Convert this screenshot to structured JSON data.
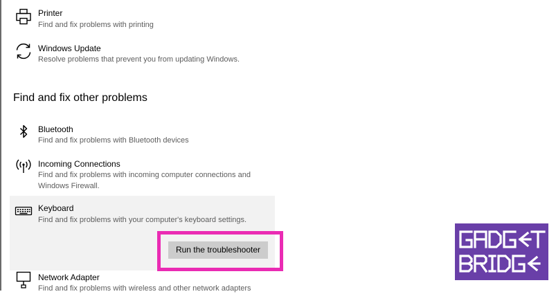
{
  "troubleshooters_top": [
    {
      "title": "Printer",
      "description": "Find and fix problems with printing",
      "icon": "printer-icon"
    },
    {
      "title": "Windows Update",
      "description": "Resolve problems that prevent you from updating Windows.",
      "icon": "refresh-icon"
    }
  ],
  "section": {
    "title": "Find and fix other problems"
  },
  "troubleshooters_other": [
    {
      "title": "Bluetooth",
      "description": "Find and fix problems with Bluetooth devices",
      "icon": "bluetooth-icon"
    },
    {
      "title": "Incoming Connections",
      "description_line1": "Find and fix problems with incoming computer connections and",
      "description_line2": "Windows Firewall.",
      "icon": "antenna-icon"
    },
    {
      "title": "Keyboard",
      "description": "Find and fix problems with your computer's keyboard settings.",
      "icon": "keyboard-icon",
      "selected": true,
      "action_label": "Run the troubleshooter"
    },
    {
      "title": "Network Adapter",
      "description": "Find and fix problems with wireless and other network adapters",
      "icon": "monitor-network-icon"
    }
  ],
  "colors": {
    "highlight_border": "#ea2bb3",
    "selected_background": "#f2f2f2",
    "button_background": "#cccccc",
    "logo_background": "#693fa8"
  },
  "logo": {
    "line1": "GADG←T",
    "line2": "BRIDG←",
    "icon": "gadgetbridge-logo"
  }
}
